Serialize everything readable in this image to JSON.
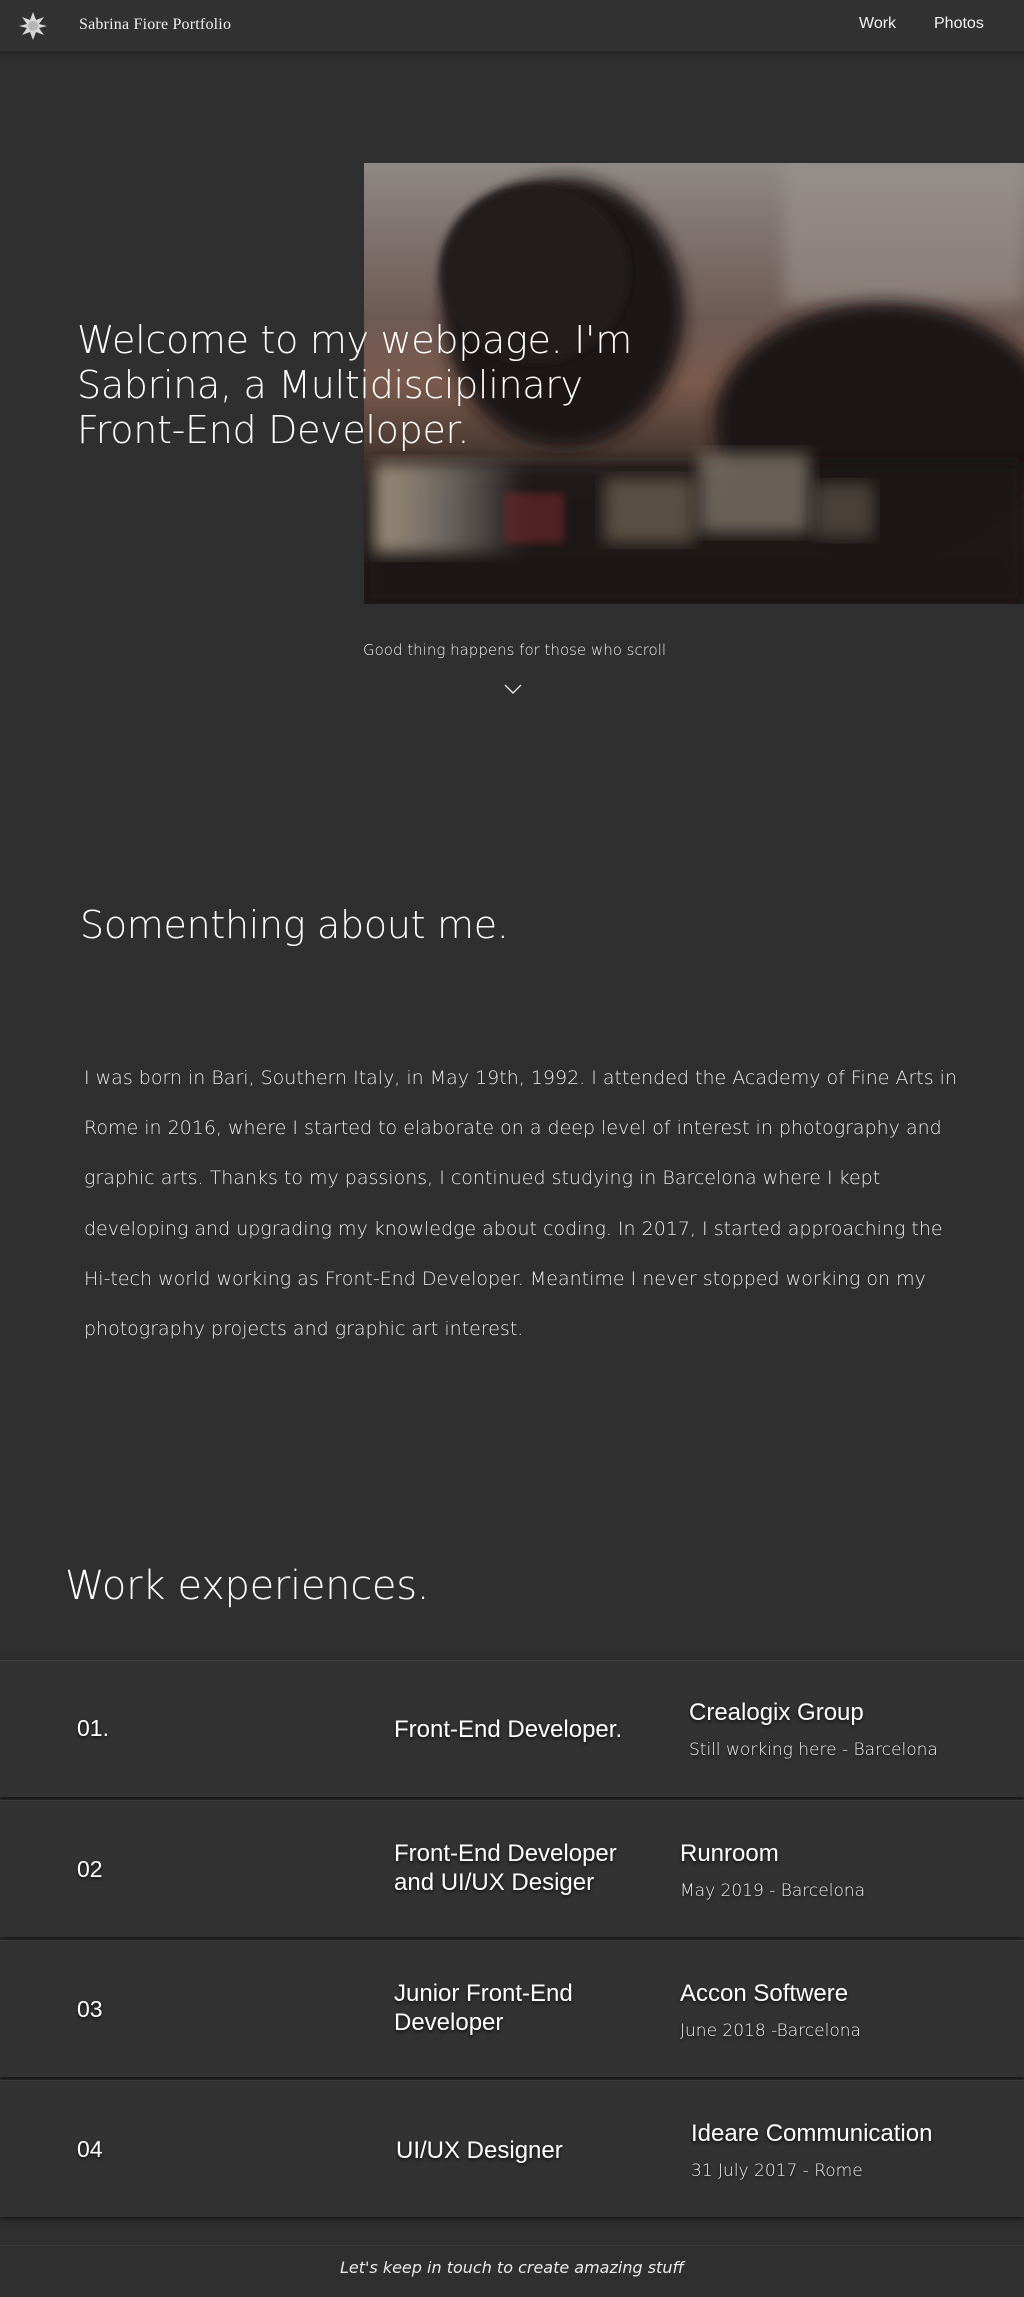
{
  "header": {
    "site_title": "Sabrina Fiore Portfolio",
    "logo_icon": "flower-star-icon",
    "nav": [
      {
        "label": "Work"
      },
      {
        "label": "Photos"
      }
    ]
  },
  "hero": {
    "heading": "Welcome to my webpage. I'm Sabrina, a Multidisciplinary Front-End Developer.",
    "scroll_hint": "Good thing happens for those who scroll",
    "scroll_icon": "chevron-down-icon"
  },
  "about": {
    "heading": "Somenthing about me.",
    "text": "I was born in Bari, Southern Italy, in May 19th, 1992. I attended the Academy of Fine Arts in Rome in 2016, where I started to elaborate on a deep level of interest in photography and graphic arts. Thanks to my passions, I continued studying in Barcelona where I kept developing and upgrading my knowledge about coding. In 2017, I started approaching the Hi-tech world working as Front-End Developer. Meantime I never stopped working on my photography projects and graphic art interest."
  },
  "work": {
    "heading": "Work experiences.",
    "jobs": [
      {
        "number": "01.",
        "role": "Front-End Developer.",
        "company": "Crealogix Group",
        "detail": "Still working here - Barcelona"
      },
      {
        "number": "02",
        "role": "Front-End Developer and UI/UX Desiger",
        "company": "Runroom",
        "detail": "May 2019 - Barcelona"
      },
      {
        "number": "03",
        "role": "Junior Front-End Developer",
        "company": "Accon Softwere",
        "detail": "June 2018 -Barcelona"
      },
      {
        "number": "04",
        "role": "UI/UX Designer",
        "company": "Ideare Communication",
        "detail": "31 July 2017 - Rome"
      }
    ]
  },
  "footer": {
    "text": "Let's keep in touch to create amazing stuff"
  },
  "colors": {
    "background": "#2f2f2f",
    "header": "#323232",
    "text": "#ffffff"
  }
}
